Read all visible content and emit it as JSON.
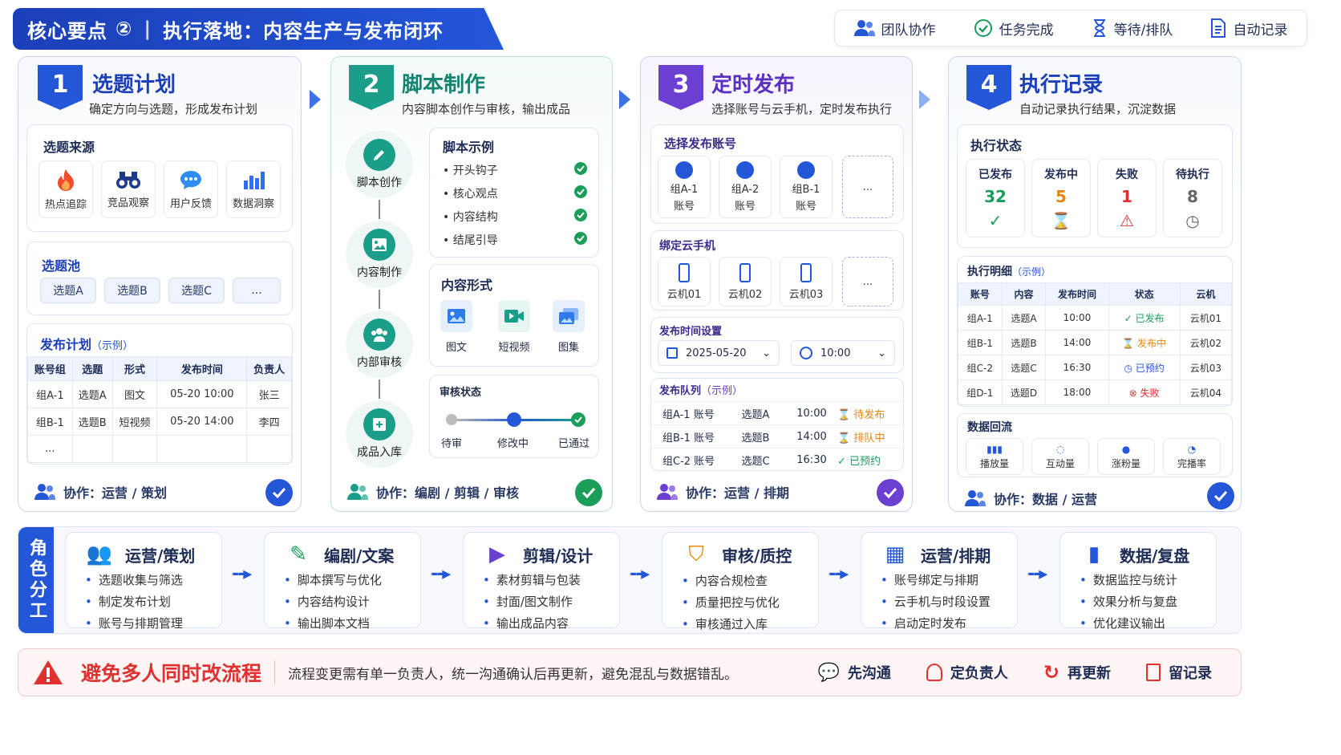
{
  "header": {
    "title_left": "核心要点",
    "title_num": "②",
    "title_right": "执行落地：内容生产与发布闭环"
  },
  "legend": [
    "团队协作",
    "任务完成",
    "等待/排队",
    "自动记录"
  ],
  "steps": [
    {
      "num": "1",
      "title": "选题计划",
      "sub": "确定方向与选题，形成发布计划",
      "color": "#2456d8",
      "collab": "协作：运营 / 策划"
    },
    {
      "num": "2",
      "title": "脚本制作",
      "sub": "内容脚本创作与审核，输出成品",
      "color": "#1a9e8a",
      "collab": "协作：编剧 / 剪辑 / 审核"
    },
    {
      "num": "3",
      "title": "定时发布",
      "sub": "选择账号与云手机，定时发布执行",
      "color": "#6a3fd1",
      "collab": "协作：运营 / 排期"
    },
    {
      "num": "4",
      "title": "执行记录",
      "sub": "自动记录执行结果，沉淀数据",
      "color": "#2456d8",
      "collab": "协作：数据 / 运营"
    }
  ],
  "s1": {
    "source_title": "选题来源",
    "sources": [
      "热点追踪",
      "竞品观察",
      "用户反馈",
      "数据洞察"
    ],
    "pool_title": "选题池",
    "pool": [
      "选题A",
      "选题B",
      "选题C",
      "..."
    ],
    "plan_title": "发布计划",
    "plan_note": "（示例）",
    "plan_head": [
      "账号组",
      "选题",
      "形式",
      "发布时间",
      "负责人"
    ],
    "plan_rows": [
      [
        "组A-1",
        "选题A",
        "图文",
        "05-20 10:00",
        "张三"
      ],
      [
        "组B-1",
        "选题B",
        "短视频",
        "05-20 14:00",
        "李四"
      ],
      [
        "...",
        "",
        "",
        "",
        ""
      ]
    ]
  },
  "s2": {
    "flow": [
      "脚本创作",
      "内容制作",
      "内部审核",
      "成品入库"
    ],
    "script_title": "脚本示例",
    "script_items": [
      "开头钩子",
      "核心观点",
      "内容结构",
      "结尾引导"
    ],
    "form_title": "内容形式",
    "forms": [
      "图文",
      "短视频",
      "图集"
    ],
    "review_title": "审核状态",
    "review_steps": [
      "待审",
      "修改中",
      "已通过"
    ]
  },
  "s3": {
    "acc_title": "选择发布账号",
    "accounts": [
      [
        "组A-1",
        "账号"
      ],
      [
        "组A-2",
        "账号"
      ],
      [
        "组B-1",
        "账号"
      ]
    ],
    "more": "...",
    "phone_title": "绑定云手机",
    "phones": [
      "云机01",
      "云机02",
      "云机03"
    ],
    "time_title": "发布时间设置",
    "date": "2025-05-20",
    "time": "10:00",
    "queue_title": "发布队列",
    "queue_note": "（示例）",
    "queue": [
      [
        "组A-1 账号",
        "选题A",
        "10:00",
        "待发布"
      ],
      [
        "组B-1 账号",
        "选题B",
        "14:00",
        "排队中"
      ],
      [
        "组C-2 账号",
        "选题C",
        "16:30",
        "已预约"
      ]
    ]
  },
  "s4": {
    "status_title": "执行状态",
    "status": [
      {
        "label": "已发布",
        "value": "32",
        "color": "#1a9e5a"
      },
      {
        "label": "发布中",
        "value": "5",
        "color": "#e8860c"
      },
      {
        "label": "失败",
        "value": "1",
        "color": "#e03131"
      },
      {
        "label": "待执行",
        "value": "8",
        "color": "#666"
      }
    ],
    "detail_title": "执行明细",
    "detail_note": "（示例）",
    "detail_head": [
      "账号",
      "内容",
      "发布时间",
      "状态",
      "云机"
    ],
    "detail_rows": [
      [
        "组A-1",
        "选题A",
        "10:00",
        "已发布",
        "云机01"
      ],
      [
        "组B-1",
        "选题B",
        "14:00",
        "发布中",
        "云机02"
      ],
      [
        "组C-2",
        "选题C",
        "16:30",
        "已预约",
        "云机03"
      ],
      [
        "组D-1",
        "选题D",
        "18:00",
        "失败",
        "云机04"
      ]
    ],
    "data_title": "数据回流",
    "data": [
      "播放量",
      "互动量",
      "涨粉量",
      "完播率"
    ]
  },
  "roles_label": "角色分工",
  "roles": [
    {
      "title": "运营/策划",
      "items": [
        "选题收集与筛选",
        "制定发布计划",
        "账号与排期管理"
      ]
    },
    {
      "title": "编剧/文案",
      "items": [
        "脚本撰写与优化",
        "内容结构设计",
        "输出脚本文档"
      ]
    },
    {
      "title": "剪辑/设计",
      "items": [
        "素材剪辑与包装",
        "封面/图文制作",
        "输出成品内容"
      ]
    },
    {
      "title": "审核/质控",
      "items": [
        "内容合规检查",
        "质量把控与优化",
        "审核通过入库"
      ]
    },
    {
      "title": "运营/排期",
      "items": [
        "账号绑定与排期",
        "云手机与时段设置",
        "启动定时发布"
      ]
    },
    {
      "title": "数据/复盘",
      "items": [
        "数据监控与统计",
        "效果分析与复盘",
        "优化建议输出"
      ]
    }
  ],
  "warning": {
    "title": "避免多人同时改流程",
    "text": "流程变更需有单一负责人，统一沟通确认后再更新，避免混乱与数据错乱。",
    "actions": [
      "先沟通",
      "定负责人",
      "再更新",
      "留记录"
    ]
  }
}
